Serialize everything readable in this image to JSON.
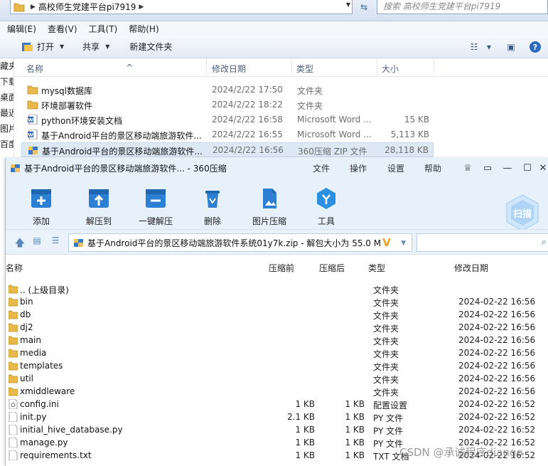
{
  "explorer": {
    "address": {
      "breadcrumb": "高校师生党建平台pi7919"
    },
    "search_placeholder": "搜索 高校师生党建平台pi7919",
    "menu": [
      "编辑(E)",
      "查看(V)",
      "工具(T)",
      "帮助(H)"
    ],
    "toolbar": {
      "open": "打开",
      "share": "共享",
      "new_folder": "新建文件夹"
    },
    "left_nav": [
      "藏夹",
      "下载",
      "桌面",
      "最近",
      "图片",
      "百度"
    ],
    "columns": {
      "name": "名称",
      "date": "修改日期",
      "type": "类型",
      "size": "大小"
    },
    "files": [
      {
        "name": "mysql数据库",
        "date": "2024/2/22 17:50",
        "type": "文件夹",
        "size": "",
        "icon": "folder-icon"
      },
      {
        "name": "环境部署软件",
        "date": "2024/2/22 18:22",
        "type": "文件夹",
        "size": "",
        "icon": "folder-icon"
      },
      {
        "name": "python环境安装文档",
        "date": "2024/2/22 16:58",
        "type": "Microsoft Word ...",
        "size": "15 KB",
        "icon": "word-doc-icon"
      },
      {
        "name": "基于Android平台的景区移动端旅游软件...",
        "date": "2024/2/22 16:55",
        "type": "Microsoft Word ...",
        "size": "5,113 KB",
        "icon": "word-doc-icon"
      },
      {
        "name": "基于Android平台的景区移动端旅游软件...",
        "date": "2024/2/22 16:56",
        "type": "360压缩 ZIP 文件",
        "size": "28,118 KB",
        "icon": "zip-archive-icon"
      }
    ]
  },
  "zip_window": {
    "title": "基于Android平台的景区移动端旅游软件... - 360压缩",
    "menu": [
      "文件",
      "操作",
      "设置",
      "帮助"
    ],
    "tools": [
      "添加",
      "解压到",
      "一键解压",
      "删除",
      "图片压缩",
      "工具"
    ],
    "scan_label": "扫描",
    "path": "基于Android平台的景区移动端旅游软件系统01y7k.zip - 解包大小为 55.0 M",
    "columns": {
      "name": "名称",
      "packed": "压缩前",
      "original": "压缩后",
      "type": "类型",
      "date": "修改日期"
    },
    "rows": [
      {
        "name": ".. (上级目录)",
        "packed": "",
        "original": "",
        "type": "文件夹",
        "date": "",
        "icon": "folder-icon"
      },
      {
        "name": "bin",
        "packed": "",
        "original": "",
        "type": "文件夹",
        "date": "2024-02-22 16:56",
        "icon": "folder-icon"
      },
      {
        "name": "db",
        "packed": "",
        "original": "",
        "type": "文件夹",
        "date": "2024-02-22 16:56",
        "icon": "folder-icon"
      },
      {
        "name": "dj2",
        "packed": "",
        "original": "",
        "type": "文件夹",
        "date": "2024-02-22 16:56",
        "icon": "folder-icon"
      },
      {
        "name": "main",
        "packed": "",
        "original": "",
        "type": "文件夹",
        "date": "2024-02-22 16:56",
        "icon": "folder-icon"
      },
      {
        "name": "media",
        "packed": "",
        "original": "",
        "type": "文件夹",
        "date": "2024-02-22 16:56",
        "icon": "folder-icon"
      },
      {
        "name": "templates",
        "packed": "",
        "original": "",
        "type": "文件夹",
        "date": "2024-02-22 16:56",
        "icon": "folder-icon"
      },
      {
        "name": "util",
        "packed": "",
        "original": "",
        "type": "文件夹",
        "date": "2024-02-22 16:56",
        "icon": "folder-icon"
      },
      {
        "name": "xmiddleware",
        "packed": "",
        "original": "",
        "type": "文件夹",
        "date": "2024-02-22 16:56",
        "icon": "folder-icon"
      },
      {
        "name": "config.ini",
        "packed": "1 KB",
        "original": "1 KB",
        "type": "配置设置",
        "date": "2024-02-22 16:52",
        "icon": "config-file-icon"
      },
      {
        "name": "init.py",
        "packed": "2.1 KB",
        "original": "1 KB",
        "type": "PY 文件",
        "date": "2024-02-22 16:52",
        "icon": "file-icon"
      },
      {
        "name": "initial_hive_database.py",
        "packed": "1 KB",
        "original": "1 KB",
        "type": "PY 文件",
        "date": "2024-02-22 16:52",
        "icon": "file-icon"
      },
      {
        "name": "manage.py",
        "packed": "1 KB",
        "original": "1 KB",
        "type": "PY 文件",
        "date": "2024-02-22 16:52",
        "icon": "file-icon"
      },
      {
        "name": "requirements.txt",
        "packed": "1 KB",
        "original": "1 KB",
        "type": "TXT 文档",
        "date": "2024-02-22 16:52",
        "icon": "file-icon"
      }
    ]
  },
  "watermark": "CSDN @承诚程序django"
}
